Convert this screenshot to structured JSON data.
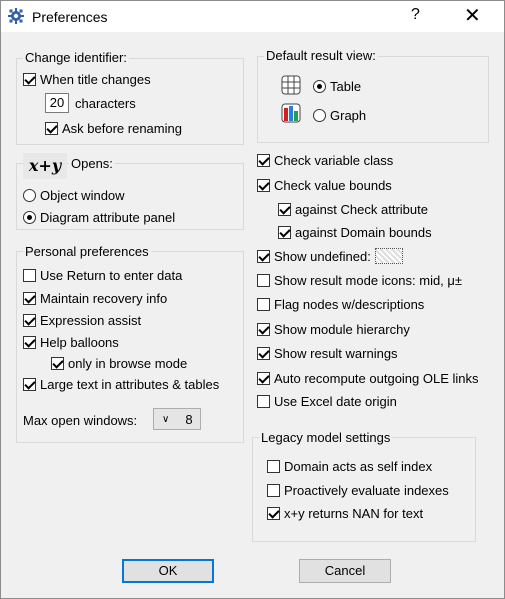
{
  "window": {
    "title": "Preferences",
    "help_label": "?",
    "close_label": "✕"
  },
  "change_identifier": {
    "title": "Change identifier:",
    "when_title_changes": "When title changes",
    "chars_value": "20",
    "chars_label": "characters",
    "ask_before_renaming": "Ask before renaming"
  },
  "opens": {
    "icon_text": "x+y",
    "title": "Opens:",
    "object_window": "Object window",
    "diagram_panel": "Diagram attribute panel"
  },
  "personal": {
    "title": "Personal preferences",
    "items": [
      "Use Return to enter data",
      "Maintain recovery info",
      "Expression assist",
      "Help balloons",
      "only in browse mode",
      "Large text in attributes & tables"
    ],
    "max_windows_label": "Max open windows:",
    "max_windows_value": "8"
  },
  "default_result": {
    "title": "Default result view:",
    "table": "Table",
    "graph": "Graph"
  },
  "right_checks": [
    "Check variable class",
    "Check value bounds",
    "against Check attribute",
    "against Domain bounds",
    "Show undefined:",
    "Show result mode icons: mid, μ±",
    "Flag nodes w/descriptions",
    "Show module hierarchy",
    "Show result warnings",
    "Auto recompute outgoing OLE links",
    "Use Excel date origin"
  ],
  "legacy": {
    "title": "Legacy model settings",
    "items": [
      "Domain acts as self index",
      "Proactively evaluate indexes",
      "x+y returns NAN for text"
    ]
  },
  "buttons": {
    "ok": "OK",
    "cancel": "Cancel"
  },
  "colors": {
    "accent": "#0078d7",
    "title_icon": "#2f5fae"
  }
}
